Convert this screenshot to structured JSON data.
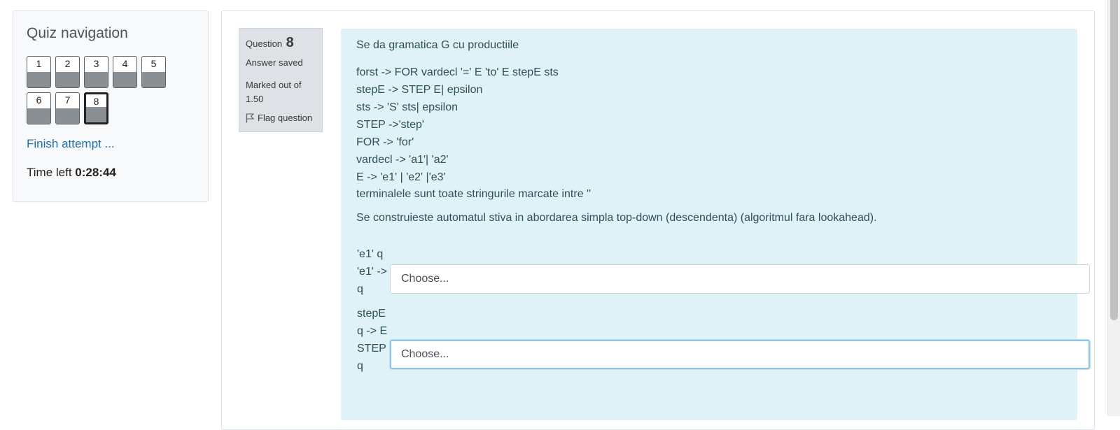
{
  "nav": {
    "title": "Quiz navigation",
    "buttons": [
      "1",
      "2",
      "3",
      "4",
      "5",
      "6",
      "7",
      "8"
    ],
    "current": "8",
    "finish_label": "Finish attempt ...",
    "time_label": "Time left",
    "time_value": "0:28:44"
  },
  "info": {
    "question_prefix": "Question",
    "question_number": "8",
    "state": "Answer saved",
    "grade": "Marked out of 1.50",
    "flag_label": "Flag question",
    "flag_icon": "flag-icon"
  },
  "question": {
    "intro": "Se da gramatica G cu productiile",
    "grammar": [
      "forst -> FOR vardecl '=' E 'to' E stepE sts",
      "stepE -> STEP E| epsilon",
      "sts -> 'S' sts| epsilon",
      "STEP ->'step'",
      "FOR -> 'for'",
      "vardecl -> 'a1'| 'a2'",
      "E -> 'e1' | 'e2' |'e3'"
    ],
    "terminals_note": "terminalele sunt toate stringurile marcate intre ''",
    "task": "Se construieste automatul stiva in abordarea simpla top-down (descendenta) (algoritmul fara lookahead).",
    "items": [
      {
        "label": "'e1' q 'e1' -> q",
        "selected": "Choose..."
      },
      {
        "label": "stepE q -> E STEP q",
        "selected": "Choose..."
      }
    ]
  }
}
